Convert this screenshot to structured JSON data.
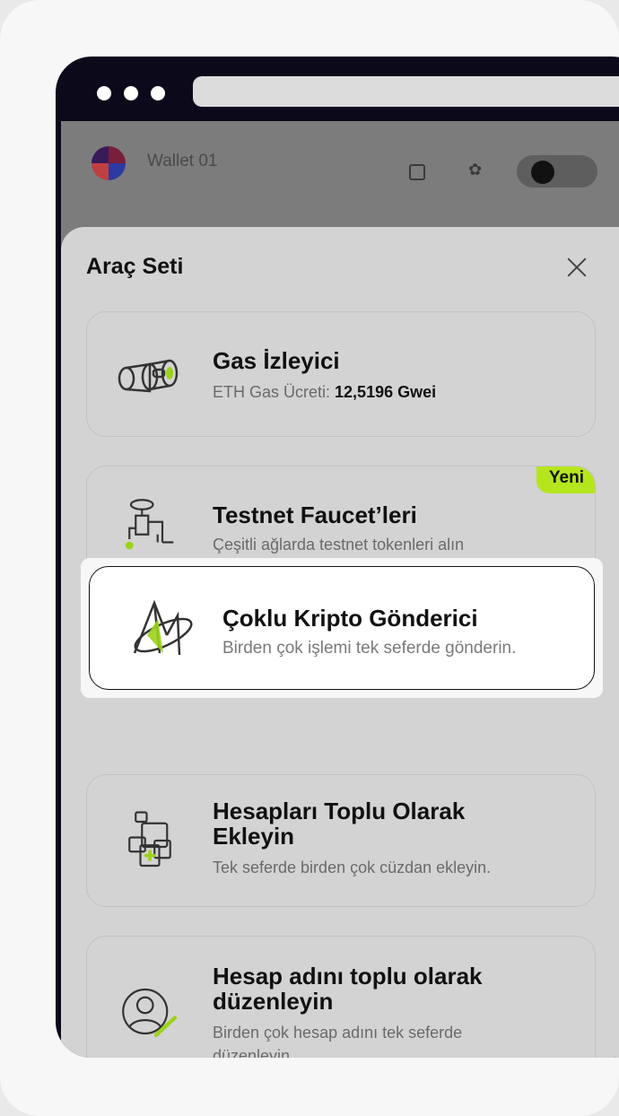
{
  "wallet": {
    "name": "Wallet 01"
  },
  "sheet": {
    "title": "Araç Seti"
  },
  "tools": [
    {
      "title": "Gas İzleyici",
      "subtitle_prefix": "ETH Gas Ücreti: ",
      "subtitle_value": "12,5196 Gwei",
      "icon": "binoculars-icon"
    },
    {
      "title": "Testnet Faucet’leri",
      "subtitle": "Çeşitli ağlarda testnet tokenleri alın",
      "badge": "Yeni",
      "icon": "faucet-icon"
    },
    {
      "title": "Çoklu Kripto Gönderici",
      "subtitle": "Birden çok işlemi tek seferde gönderin.",
      "icon": "multi-send-icon"
    },
    {
      "title_line1": "Hesapları Toplu Olarak",
      "title_line2": "Ekleyin",
      "subtitle": "Tek seferde birden çok cüzdan ekleyin.",
      "icon": "add-accounts-icon"
    },
    {
      "title_line1": "Hesap adını toplu olarak",
      "title_line2": "düzenleyin",
      "subtitle_line1": "Birden çok hesap adını tek seferde",
      "subtitle_line2": "düzenleyin",
      "icon": "edit-profile-icon"
    }
  ],
  "colors": {
    "accent": "#b5e61d",
    "device_frame": "#0c0a1a",
    "overlay": "#d3d3d3"
  }
}
